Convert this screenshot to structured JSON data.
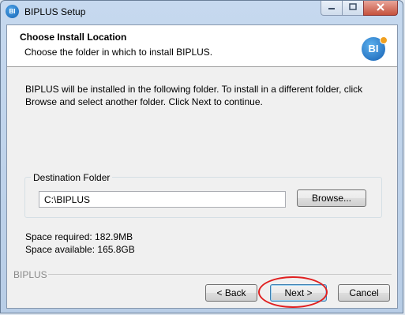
{
  "window": {
    "title": "BIPLUS Setup",
    "app_icon_text": "BI",
    "caption_buttons": [
      "minimize-icon",
      "maximize-icon",
      "close-icon"
    ]
  },
  "header": {
    "title": "Choose Install Location",
    "subtitle": "Choose the folder in which to install BIPLUS.",
    "logo_text": "BI"
  },
  "body": {
    "description": "BIPLUS will be installed in the following folder. To install in a different folder, click Browse and select another folder. Click Next to continue.",
    "destination": {
      "group_label": "Destination Folder",
      "path_value": "C:\\BIPLUS",
      "browse_label": "Browse..."
    },
    "space_required": "Space required: 182.9MB",
    "space_available": "Space available: 165.8GB"
  },
  "footer": {
    "brand": "BIPLUS",
    "back_label": "< Back",
    "next_label": "Next >",
    "cancel_label": "Cancel"
  },
  "colors": {
    "annotation": "#e02020",
    "accent": "#1565b5"
  }
}
